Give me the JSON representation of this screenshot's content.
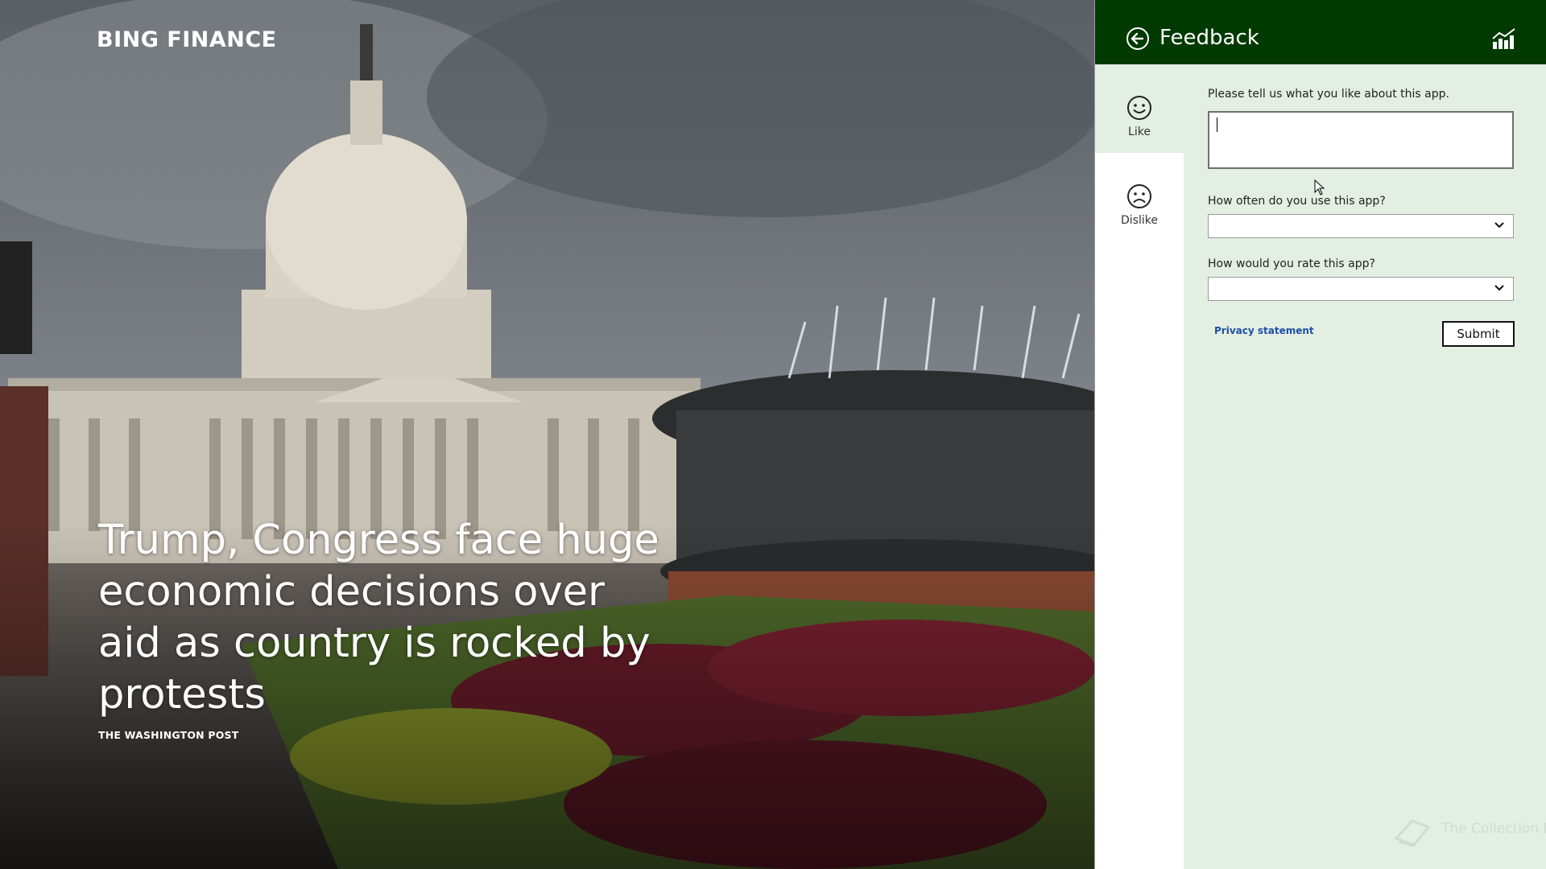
{
  "app": {
    "title": "BING FINANCE"
  },
  "hero": {
    "headline": "Trump, Congress face huge economic decisions over aid as country is rocked by protests",
    "source": "THE WASHINGTON POST"
  },
  "panel": {
    "title": "Feedback",
    "header_color": "#003a00",
    "tabs": [
      {
        "label": "Like",
        "icon": "smiley-happy-icon",
        "active": true
      },
      {
        "label": "Dislike",
        "icon": "smiley-sad-icon",
        "active": false
      }
    ],
    "form": {
      "question_like": "Please tell us what you like about this app.",
      "comment_value": "",
      "usage_question": "How often do you use this app?",
      "usage_selected": "",
      "rating_question": "How would you rate this app?",
      "rating_selected": "",
      "privacy_link": "Privacy statement",
      "submit_label": "Submit"
    },
    "watermark": "The Collection Book"
  }
}
